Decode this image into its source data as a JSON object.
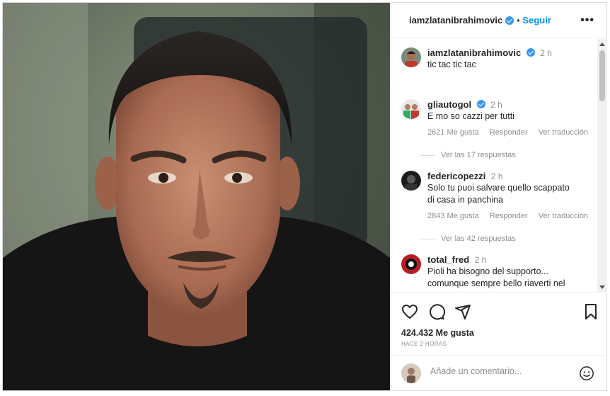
{
  "post": {
    "author": "iamzlatanibrahimovic",
    "follow_label": "Seguir",
    "more_icon": "more-options-icon",
    "more_glyph": "•••"
  },
  "caption": {
    "username": "iamzlatanibrahimovic",
    "time": "2 h",
    "text": "tic tac tic tac"
  },
  "comments": [
    {
      "username": "gliautogol",
      "verified": true,
      "time": "2 h",
      "text": "E mo so cazzi per tutti",
      "likes": "2621 Me gusta",
      "reply_label": "Responder",
      "translate_label": "Ver traducción",
      "replies_label": "Ver las 17 respuestas"
    },
    {
      "username": "federicopezzi",
      "verified": false,
      "time": "2 h",
      "text": "Solo tu puoi salvare quello scappato di casa in panchina",
      "likes": "2843 Me gusta",
      "reply_label": "Responder",
      "translate_label": "Ver traducción",
      "replies_label": "Ver las 42 respuestas"
    },
    {
      "username": "total_fred",
      "verified": false,
      "time": "2 h",
      "text": "Pioli ha bisogno del supporto... comunque sempre bello riaverti nel"
    }
  ],
  "actions": {
    "like_icon": "heart-icon",
    "comment_icon": "comment-icon",
    "share_icon": "share-icon",
    "save_icon": "bookmark-icon",
    "likes_count": "424.432 Me gusta",
    "time_ago": "HACE 2 HORAS"
  },
  "add_comment": {
    "placeholder": "Añade un comentario...",
    "emoji_icon": "smile-icon"
  },
  "colors": {
    "accent": "#0095f6",
    "verified": "#3897f0",
    "muted": "#8e8e8e",
    "text": "#262626"
  }
}
